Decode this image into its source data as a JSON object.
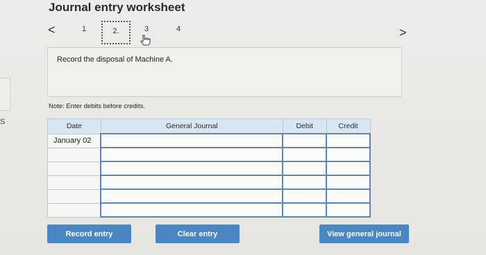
{
  "title": "Journal entry worksheet",
  "nav": {
    "prev": "<",
    "next": ">",
    "pages": [
      "1",
      "2.",
      "3",
      "4"
    ]
  },
  "left_edge_glyph": "S",
  "instruction": "Record the disposal of Machine A.",
  "note": "Note: Enter debits before credits.",
  "table": {
    "headers": [
      "Date",
      "General Journal",
      "Debit",
      "Credit"
    ],
    "rows": [
      {
        "date": "January 02",
        "account": "",
        "debit": "",
        "credit": ""
      },
      {
        "date": "",
        "account": "",
        "debit": "",
        "credit": ""
      },
      {
        "date": "",
        "account": "",
        "debit": "",
        "credit": ""
      },
      {
        "date": "",
        "account": "",
        "debit": "",
        "credit": ""
      },
      {
        "date": "",
        "account": "",
        "debit": "",
        "credit": ""
      },
      {
        "date": "",
        "account": "",
        "debit": "",
        "credit": ""
      }
    ]
  },
  "buttons": {
    "record": "Record entry",
    "clear": "Clear entry",
    "view": "View general journal"
  },
  "colors": {
    "button_bg": "#4a86c2",
    "header_bg": "#d7e6f1",
    "input_border": "#5b86b0"
  }
}
